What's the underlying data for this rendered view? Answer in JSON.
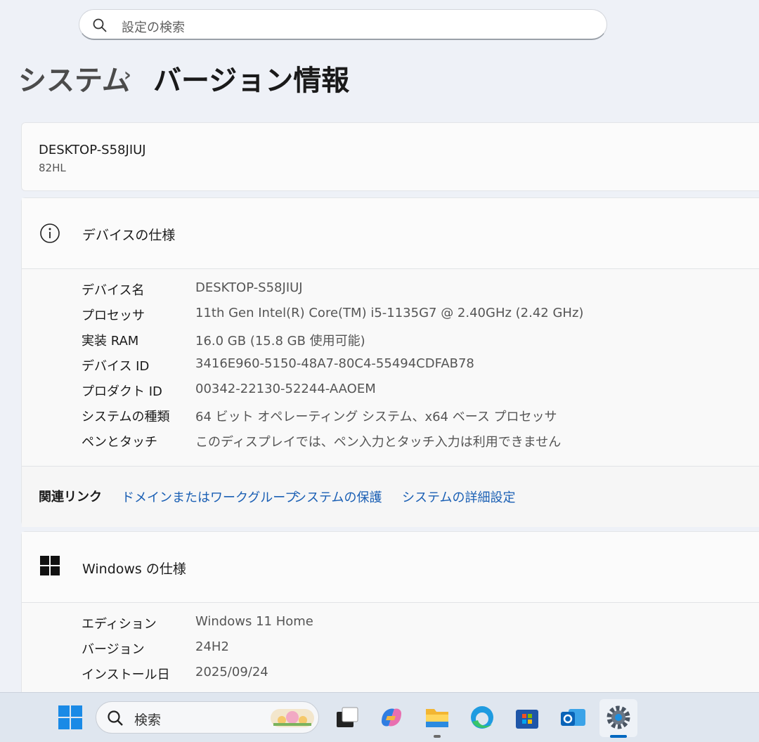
{
  "search": {
    "placeholder": "設定の検索"
  },
  "breadcrumb": {
    "parent": "システム",
    "separator": "›",
    "current": "バージョン情報"
  },
  "device": {
    "name": "DESKTOP-S58JIUJ",
    "model": "82HL"
  },
  "device_specs": {
    "title": "デバイスの仕様",
    "rows": [
      {
        "key": "デバイス名",
        "value": "DESKTOP-S58JIUJ"
      },
      {
        "key": "プロセッサ",
        "value": "11th Gen Intel(R) Core(TM) i5-1135G7 @ 2.40GHz (2.42 GHz)"
      },
      {
        "key": "実装 RAM",
        "value": "16.0 GB (15.8 GB 使用可能)"
      },
      {
        "key": "デバイス ID",
        "value": "3416E960-5150-48A7-80C4-55494CDFAB78"
      },
      {
        "key": "プロダクト ID",
        "value": "00342-22130-52244-AAOEM"
      },
      {
        "key": "システムの種類",
        "value": "64 ビット オペレーティング システム、x64 ベース プロセッサ"
      },
      {
        "key": "ペンとタッチ",
        "value": "このディスプレイでは、ペン入力とタッチ入力は利用できません"
      }
    ]
  },
  "related_links": {
    "title": "関連リンク",
    "links": [
      "ドメインまたはワークグループ",
      "システムの保護",
      "システムの詳細設定"
    ]
  },
  "windows_specs": {
    "title": "Windows の仕様",
    "rows": [
      {
        "key": "エディション",
        "value": "Windows 11 Home"
      },
      {
        "key": "バージョン",
        "value": "24H2"
      },
      {
        "key": "インストール日",
        "value": "2025/09/24"
      }
    ]
  },
  "taskbar": {
    "search_label": "検索",
    "icons": [
      "windows-start-icon",
      "search-icon",
      "task-view-icon",
      "copilot-icon",
      "file-explorer-icon",
      "edge-icon",
      "store-icon",
      "outlook-icon",
      "settings-icon"
    ]
  },
  "colors": {
    "accent": "#0067c0",
    "link": "#1a5fb4",
    "background": "#eef1f7"
  }
}
